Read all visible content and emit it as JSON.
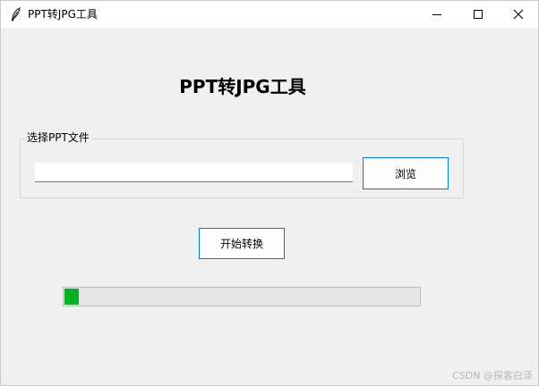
{
  "window": {
    "title": "PPT转JPG工具",
    "icon": "feather-icon"
  },
  "heading": "PPT转JPG工具",
  "file_group": {
    "label": "选择PPT文件",
    "path_value": "",
    "browse_label": "浏览"
  },
  "actions": {
    "start_label": "开始转换"
  },
  "progress": {
    "value": 0.04,
    "color": "#06b025"
  },
  "watermark": "CSDN @探客白泽"
}
